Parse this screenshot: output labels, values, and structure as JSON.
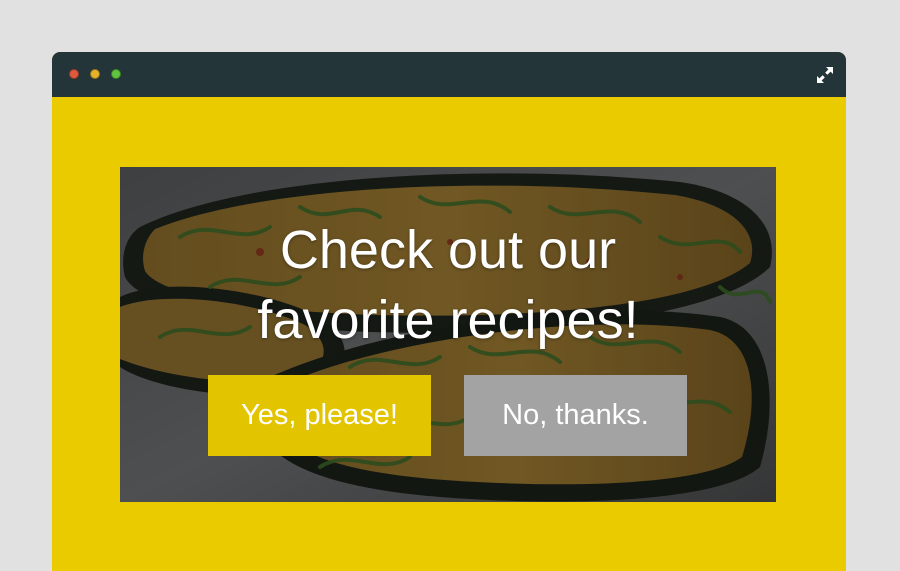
{
  "window": {
    "controls": [
      "close-dot",
      "minimize-dot",
      "maximize-dot"
    ],
    "expand_icon": "expand-arrows-icon",
    "accent_color": "#e9cb00",
    "titlebar_color": "#243539"
  },
  "popup": {
    "image": "grilled-eggplant-food-photo",
    "title_line1": "Check out our",
    "title_line2": "favorite recipes!",
    "yes_label": "Yes, please!",
    "no_label": "No, thanks.",
    "yes_color": "#e2c400",
    "no_color": "#a3a3a3"
  }
}
